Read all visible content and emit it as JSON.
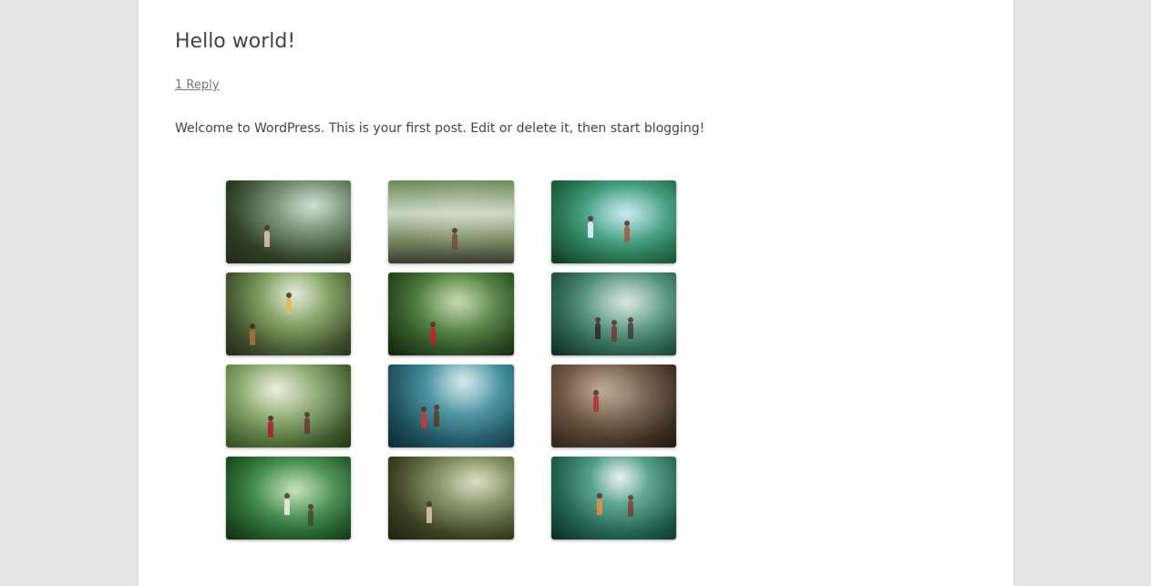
{
  "post": {
    "title": "Hello world!",
    "comments_link": "1 Reply",
    "content": "Welcome to WordPress. This is your first post. Edit or delete it, then start blogging!"
  },
  "gallery": {
    "columns": 3,
    "items": [
      {
        "name": "gallery-image-1"
      },
      {
        "name": "gallery-image-2"
      },
      {
        "name": "gallery-image-3"
      },
      {
        "name": "gallery-image-4"
      },
      {
        "name": "gallery-image-5"
      },
      {
        "name": "gallery-image-6"
      },
      {
        "name": "gallery-image-7"
      },
      {
        "name": "gallery-image-8"
      },
      {
        "name": "gallery-image-9"
      },
      {
        "name": "gallery-image-10"
      },
      {
        "name": "gallery-image-11"
      },
      {
        "name": "gallery-image-12"
      }
    ]
  },
  "colors": {
    "background": "#e6e6e6",
    "page": "#ffffff",
    "title": "#444444",
    "meta": "#757575"
  }
}
